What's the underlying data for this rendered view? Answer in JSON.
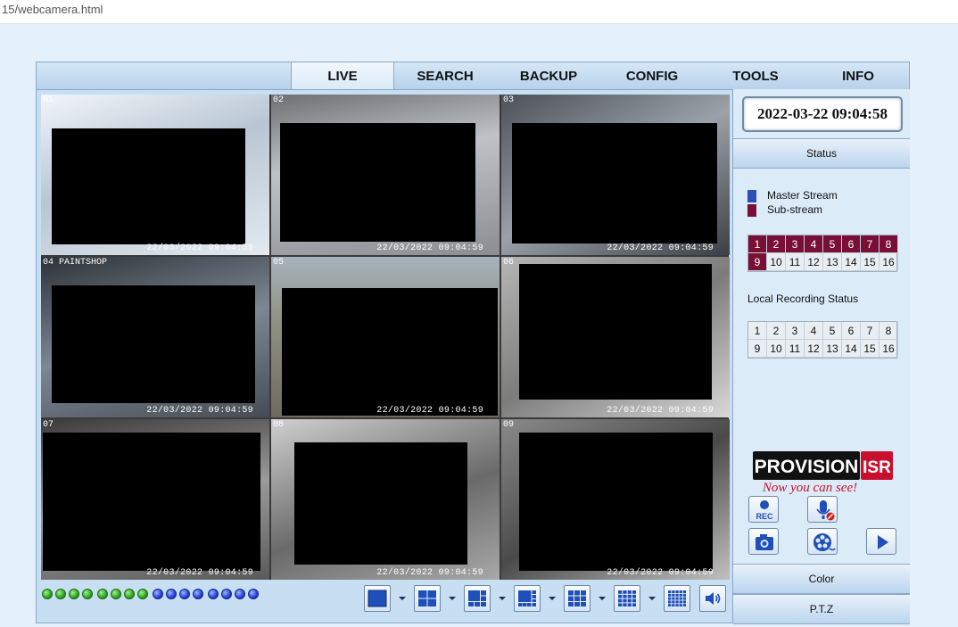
{
  "browser": {
    "url": "15/webcamera.html"
  },
  "nav": {
    "tabs": [
      {
        "label": "LIVE",
        "active": true
      },
      {
        "label": "SEARCH"
      },
      {
        "label": "BACKUP"
      },
      {
        "label": "CONFIG"
      },
      {
        "label": "TOOLS"
      },
      {
        "label": "INFO"
      }
    ]
  },
  "cameras": [
    {
      "num": "01",
      "timestamp": "22/03/2022 09:04:59",
      "selected": true
    },
    {
      "num": "02",
      "timestamp": "22/03/2022 09:04:59"
    },
    {
      "num": "03",
      "timestamp": "22/03/2022 09:04:59"
    },
    {
      "num": "04",
      "timestamp": "22/03/2022 09:04:59",
      "overlay": "PAINTSHOP"
    },
    {
      "num": "05",
      "timestamp": "22/03/2022 09:04:59"
    },
    {
      "num": "06",
      "timestamp": "22/03/2022 09:04:59"
    },
    {
      "num": "07",
      "timestamp": "22/03/2022 09:04:59"
    },
    {
      "num": "08",
      "timestamp": "22/03/2022 09:04:59"
    },
    {
      "num": "09",
      "timestamp": "22/03/2022 09:04:59"
    }
  ],
  "channel_dots": {
    "green": 8,
    "blue": 8,
    "green_color": "#2ea11d",
    "blue_color": "#2340d8"
  },
  "layout_buttons": [
    "layout-1-icon",
    "layout-4-icon",
    "layout-6-icon",
    "layout-8-icon",
    "layout-9-icon",
    "layout-16-icon",
    "layout-25-icon",
    "audio-icon"
  ],
  "right": {
    "datetime": "2022-03-22 09:04:58",
    "status_label": "Status",
    "legend": [
      {
        "label": "Master Stream",
        "color": "#2d4fb8"
      },
      {
        "label": "Sub-stream",
        "color": "#7a0f35"
      }
    ],
    "stream_channels": [
      "1",
      "2",
      "3",
      "4",
      "5",
      "6",
      "7",
      "8",
      "9",
      "10",
      "11",
      "12",
      "13",
      "14",
      "15",
      "16"
    ],
    "substream_active": 9,
    "local_recording_label": "Local Recording Status",
    "record_channels": [
      "1",
      "2",
      "3",
      "4",
      "5",
      "6",
      "7",
      "8",
      "9",
      "10",
      "11",
      "12",
      "13",
      "14",
      "15",
      "16"
    ],
    "logo": {
      "brand": "PROVISION",
      "suffix": "ISR",
      "tagline": "Now you can see!"
    },
    "actions": {
      "rec_label": "REC"
    },
    "color_label": "Color",
    "ptz_label": "P.T.Z"
  }
}
